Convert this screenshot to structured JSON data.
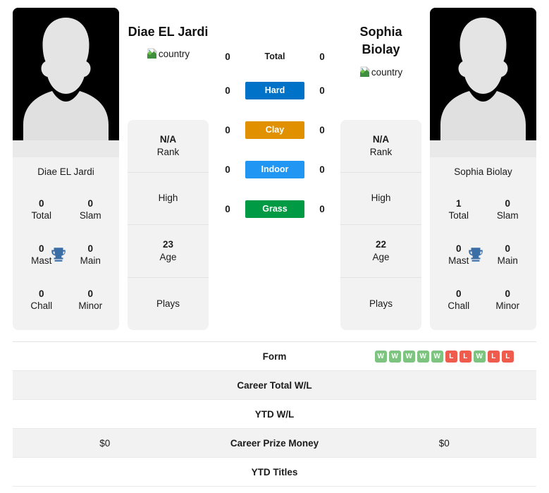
{
  "players": {
    "left": {
      "name": "Diae EL Jardi",
      "photo_name": "Diae EL Jardi",
      "country_alt": "country",
      "rank_value": "N/A",
      "rank_label": "Rank",
      "high_value": "",
      "high_label": "High",
      "age_value": "23",
      "age_label": "Age",
      "plays_value": "",
      "plays_label": "Plays",
      "titles": [
        {
          "num": "0",
          "label": "Total"
        },
        {
          "num": "0",
          "label": "Slam"
        },
        {
          "num": "0",
          "label": "Mast"
        },
        {
          "num": "0",
          "label": "Main"
        },
        {
          "num": "0",
          "label": "Chall"
        },
        {
          "num": "0",
          "label": "Minor"
        }
      ]
    },
    "right": {
      "name": "Sophia Biolay",
      "photo_name": "Sophia Biolay",
      "country_alt": "country",
      "rank_value": "N/A",
      "rank_label": "Rank",
      "high_value": "",
      "high_label": "High",
      "age_value": "22",
      "age_label": "Age",
      "plays_value": "",
      "plays_label": "Plays",
      "titles": [
        {
          "num": "1",
          "label": "Total"
        },
        {
          "num": "0",
          "label": "Slam"
        },
        {
          "num": "0",
          "label": "Mast"
        },
        {
          "num": "0",
          "label": "Main"
        },
        {
          "num": "0",
          "label": "Chall"
        },
        {
          "num": "0",
          "label": "Minor"
        }
      ]
    }
  },
  "surfaces": [
    {
      "label": "Total",
      "left": "0",
      "right": "0",
      "color": "transparent",
      "plain": true
    },
    {
      "label": "Hard",
      "left": "0",
      "right": "0",
      "color": "#0073c8",
      "plain": false
    },
    {
      "label": "Clay",
      "left": "0",
      "right": "0",
      "color": "#e19100",
      "plain": false
    },
    {
      "label": "Indoor",
      "left": "0",
      "right": "0",
      "color": "#2196f3",
      "plain": false
    },
    {
      "label": "Grass",
      "left": "0",
      "right": "0",
      "color": "#009944",
      "plain": false
    }
  ],
  "table_rows": [
    {
      "label": "Form",
      "left": "",
      "right": "",
      "type": "form"
    },
    {
      "label": "Career Total W/L",
      "left": "",
      "right": "",
      "type": "text"
    },
    {
      "label": "YTD W/L",
      "left": "",
      "right": "",
      "type": "text"
    },
    {
      "label": "Career Prize Money",
      "left": "$0",
      "right": "$0",
      "type": "text"
    },
    {
      "label": "YTD Titles",
      "left": "",
      "right": "",
      "type": "text"
    }
  ],
  "form": {
    "results": [
      "W",
      "W",
      "W",
      "W",
      "W",
      "L",
      "L",
      "W",
      "L",
      "L"
    ],
    "win_color": "#7cc47f",
    "loss_color": "#ef5b4c"
  },
  "colors": {
    "card_bg": "#f2f2f2",
    "row_alt_bg": "#f2f2f2",
    "trophy": "#3a6ea5"
  }
}
